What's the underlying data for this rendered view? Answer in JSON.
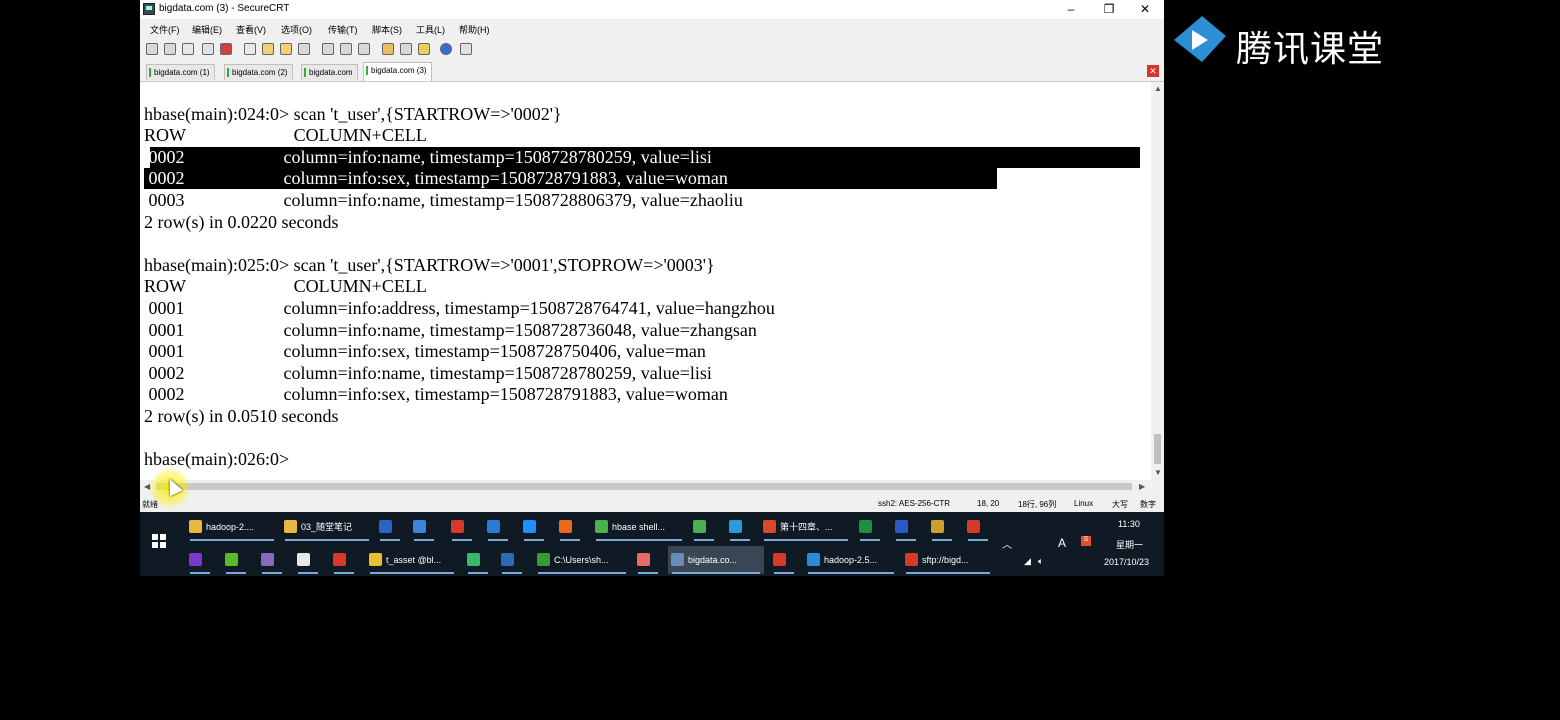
{
  "window": {
    "title": "bigdata.com (3) - SecureCRT",
    "controls": [
      "–",
      "❐",
      "✕"
    ]
  },
  "menu": [
    "文件(F)",
    "编辑(E)",
    "查看(V)",
    "选项(O)",
    "传输(T)",
    "脚本(S)",
    "工具(L)",
    "帮助(H)"
  ],
  "tabs": [
    "bigdata.com (1)",
    "bigdata.com (2)",
    "bigdata.com",
    "bigdata.com (3)"
  ],
  "terminal": {
    "lines": [
      "hbase(main):024:0> scan 't_user',{STARTROW=>'0002'}",
      "ROW                        COLUMN+CELL",
      " 0002                      column=info:name, timestamp=1508728780259, value=lisi",
      " 0002                      column=info:sex, timestamp=1508728791883, value=woman",
      " 0003                      column=info:name, timestamp=1508728806379, value=zhaoliu",
      "2 row(s) in 0.0220 seconds",
      "",
      "hbase(main):025:0> scan 't_user',{STARTROW=>'0001',STOPROW=>'0003'}",
      "ROW                        COLUMN+CELL",
      " 0001                      column=info:address, timestamp=1508728764741, value=hangzhou",
      " 0001                      column=info:name, timestamp=1508728736048, value=zhangsan",
      " 0001                      column=info:sex, timestamp=1508728750406, value=man",
      " 0002                      column=info:name, timestamp=1508728780259, value=lisi",
      " 0002                      column=info:sex, timestamp=1508728791883, value=woman",
      "2 row(s) in 0.0510 seconds",
      "",
      "hbase(main):026:0>"
    ]
  },
  "status": {
    "ready": "就绪",
    "protocol": "ssh2: AES-256-CTR",
    "cursor_pos": "18,  20",
    "size": "18行, 96列",
    "os": "Linux",
    "caps": "大写",
    "num": "数字"
  },
  "taskbar": {
    "row1": [
      {
        "label": "hadoop-2....",
        "color": "#e8b840"
      },
      {
        "label": "03_随堂笔记",
        "color": "#e8b840"
      },
      {
        "label": "",
        "color": "#2a63c9"
      },
      {
        "label": "",
        "color": "#3a86d8"
      },
      {
        "label": "",
        "color": "#d83a2a"
      },
      {
        "label": "",
        "color": "#2a7bd8"
      },
      {
        "label": "",
        "color": "#1e90ff"
      },
      {
        "label": "",
        "color": "#e86a1a"
      },
      {
        "label": "hbase shell...",
        "color": "#4caf50"
      },
      {
        "label": "",
        "color": "#4caf50"
      },
      {
        "label": "",
        "color": "#2a9ad8"
      },
      {
        "label": "第十四章、...",
        "color": "#d84a2a"
      },
      {
        "label": "",
        "color": "#1f8f3f"
      },
      {
        "label": "",
        "color": "#2a5ac9"
      },
      {
        "label": "",
        "color": "#c9a02a"
      },
      {
        "label": "",
        "color": "#d83a2a"
      }
    ],
    "row2": [
      {
        "label": "",
        "color": "#7a3ac9"
      },
      {
        "label": "",
        "color": "#5ab82a"
      },
      {
        "label": "",
        "color": "#8a6ab8"
      },
      {
        "label": "",
        "color": "#e8e8e8"
      },
      {
        "label": "",
        "color": "#d83a2a"
      },
      {
        "label": "t_asset @bl...",
        "color": "#e8c030"
      },
      {
        "label": "",
        "color": "#3ab86a"
      },
      {
        "label": "",
        "color": "#2a6ab8"
      },
      {
        "label": "C:\\Users\\sh...",
        "color": "#3a9a3a"
      },
      {
        "label": "",
        "color": "#e86a6a"
      },
      {
        "label": "bigdata.co...",
        "color": "#6a8ab8"
      },
      {
        "label": "",
        "color": "#d83a2a"
      },
      {
        "label": "hadoop-2.5...",
        "color": "#2a8ad8"
      },
      {
        "label": "sftp://bigd...",
        "color": "#d83a2a"
      }
    ],
    "tray": {
      "time": "11:30",
      "weekday": "星期一",
      "date": "2017/10/23",
      "ime": "A"
    }
  },
  "logo": {
    "text": "腾讯课堂"
  },
  "colors": {
    "logo_blue": "#2b8fd6",
    "taskbar": "#0f1a24",
    "selection": "#000000"
  }
}
